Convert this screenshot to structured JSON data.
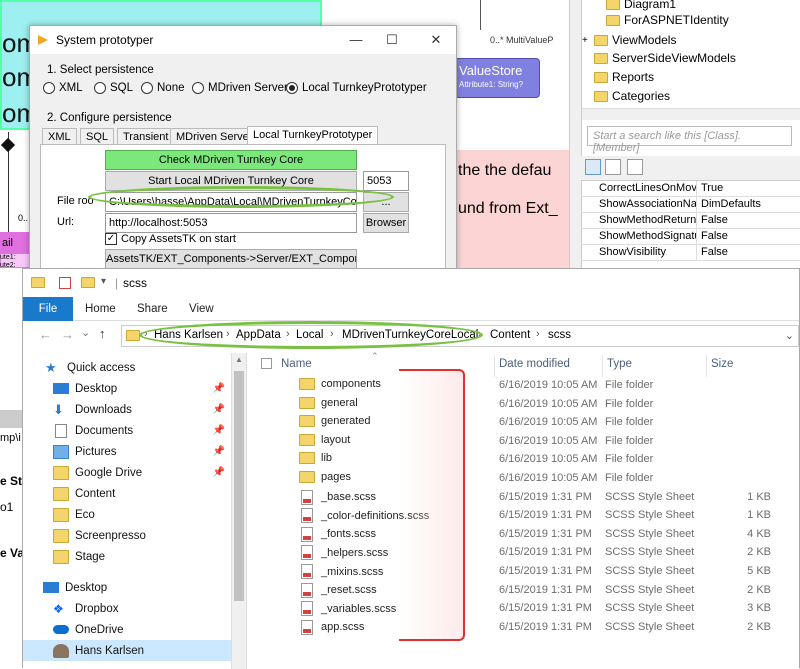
{
  "bg": {
    "big_text": [
      "om",
      "om",
      "om"
    ],
    "pink_label": "ail",
    "pink_attrs": [
      "ute1:",
      "ute2:",
      "ouble",
      "Doub",
      "Colo",
      "Radiu"
    ],
    "left_label_0x": "0..",
    "canvas_label": "0..* MultiValueP",
    "value_store_title": "ValueStore",
    "value_store_attr": "Attribute1: String?",
    "canvas_text_1": "the the defau",
    "canvas_text_2": "und from Ext_",
    "canvas_text_3": "Mu     D     I   f",
    "side_frag_1": "mp\\i",
    "side_frag_2": "e St",
    "side_frag_3": "o1",
    "side_frag_4": "e Va"
  },
  "tree": {
    "items": [
      {
        "label": "Diagram1",
        "indent": 1
      },
      {
        "label": "ForASPNETIdentity",
        "indent": 1
      },
      {
        "label": "ViewModels",
        "indent": 0,
        "expander": "+"
      },
      {
        "label": "ServerSideViewModels",
        "indent": 0
      },
      {
        "label": "Reports",
        "indent": 0
      },
      {
        "label": "Categories",
        "indent": 0
      }
    ],
    "search_placeholder": "Start a search like this [Class].[Member]"
  },
  "props": [
    {
      "name": "CorrectLinesOnMove",
      "value": "True"
    },
    {
      "name": "ShowAssociationNam",
      "value": "DimDefaults"
    },
    {
      "name": "ShowMethodReturnT",
      "value": "False"
    },
    {
      "name": "ShowMethodSignatu",
      "value": "False"
    },
    {
      "name": "ShowVisibility",
      "value": "False"
    }
  ],
  "dialog": {
    "title": "System prototyper",
    "minimize": "—",
    "maximize": "☐",
    "close": "✕",
    "section1": "1. Select persistence",
    "radios": [
      {
        "label": "XML",
        "selected": false
      },
      {
        "label": "SQL",
        "selected": false
      },
      {
        "label": "None",
        "selected": false
      },
      {
        "label": "MDriven Server",
        "selected": false
      },
      {
        "label": "Local TurnkeyPrototyper",
        "selected": true
      }
    ],
    "section2": "2. Configure persistence",
    "tabs": [
      {
        "label": "XML",
        "active": false
      },
      {
        "label": "SQL",
        "active": false
      },
      {
        "label": "Transient",
        "active": false
      },
      {
        "label": "MDriven Server",
        "active": false
      },
      {
        "label": "Local TurnkeyPrototyper",
        "active": true
      }
    ],
    "check_btn": "Check MDriven Turnkey Core",
    "start_btn": "Start Local MDriven Turnkey Core",
    "port": "5053",
    "file_root_label": "File roo",
    "file_root_value": "C:\\Users\\hasse\\AppData\\Local\\MDrivenTurnkeyCoreLoca",
    "browse_dots": "...",
    "url_label": "Url:",
    "url_value": "http://localhost:5053",
    "browser_btn": "Browser",
    "copy_label": "Copy AssetsTK on start",
    "assets_btn": "AssetsTK/EXT_Components->Server/EXT_Components"
  },
  "explorer": {
    "title": "scss",
    "title_sep": "|",
    "ribbon": [
      "File",
      "Home",
      "Share",
      "View"
    ],
    "breadcrumbs": [
      "Hans Karlsen",
      "AppData",
      "Local",
      "MDrivenTurnkeyCoreLocal",
      "Content",
      "scss"
    ],
    "nav_back": "←",
    "nav_forward": "→",
    "nav_recent": "⌄",
    "nav_up": "↑",
    "addr_chevron": "⌄",
    "nav": [
      {
        "label": "Quick access",
        "icon": "star-icon",
        "pinned": false
      },
      {
        "label": "Desktop",
        "icon": "desktop-icon",
        "pinned": true
      },
      {
        "label": "Downloads",
        "icon": "download-icon",
        "pinned": true
      },
      {
        "label": "Documents",
        "icon": "documents-icon",
        "pinned": true
      },
      {
        "label": "Pictures",
        "icon": "pictures-icon",
        "pinned": true
      },
      {
        "label": "Google Drive",
        "icon": "folder-icon",
        "pinned": true
      },
      {
        "label": "Content",
        "icon": "folder-icon",
        "pinned": false
      },
      {
        "label": "Eco",
        "icon": "folder-icon",
        "pinned": false
      },
      {
        "label": "Screenpresso",
        "icon": "folder-icon",
        "pinned": false
      },
      {
        "label": "Stage",
        "icon": "folder-icon",
        "pinned": false
      },
      {
        "label": "Desktop",
        "icon": "desktop-icon",
        "pinned": false
      },
      {
        "label": "Dropbox",
        "icon": "dropbox-icon",
        "pinned": false
      },
      {
        "label": "OneDrive",
        "icon": "cloud-icon",
        "pinned": false
      },
      {
        "label": "Hans Karlsen",
        "icon": "user-icon",
        "pinned": false
      }
    ],
    "columns": {
      "name": "Name",
      "date": "Date modified",
      "type": "Type",
      "size": "Size"
    },
    "files": [
      {
        "name": "components",
        "date": "6/16/2019 10:05 AM",
        "type": "File folder",
        "size": "",
        "kind": "folder"
      },
      {
        "name": "general",
        "date": "6/16/2019 10:05 AM",
        "type": "File folder",
        "size": "",
        "kind": "folder"
      },
      {
        "name": "generated",
        "date": "6/16/2019 10:05 AM",
        "type": "File folder",
        "size": "",
        "kind": "folder"
      },
      {
        "name": "layout",
        "date": "6/16/2019 10:05 AM",
        "type": "File folder",
        "size": "",
        "kind": "folder"
      },
      {
        "name": "lib",
        "date": "6/16/2019 10:05 AM",
        "type": "File folder",
        "size": "",
        "kind": "folder"
      },
      {
        "name": "pages",
        "date": "6/16/2019 10:05 AM",
        "type": "File folder",
        "size": "",
        "kind": "folder"
      },
      {
        "name": "_base.scss",
        "date": "6/15/2019 1:31 PM",
        "type": "SCSS Style Sheet",
        "size": "1 KB",
        "kind": "file"
      },
      {
        "name": "_color-definitions.scss",
        "date": "6/15/2019 1:31 PM",
        "type": "SCSS Style Sheet",
        "size": "1 KB",
        "kind": "file"
      },
      {
        "name": "_fonts.scss",
        "date": "6/15/2019 1:31 PM",
        "type": "SCSS Style Sheet",
        "size": "4 KB",
        "kind": "file"
      },
      {
        "name": "_helpers.scss",
        "date": "6/15/2019 1:31 PM",
        "type": "SCSS Style Sheet",
        "size": "2 KB",
        "kind": "file"
      },
      {
        "name": "_mixins.scss",
        "date": "6/15/2019 1:31 PM",
        "type": "SCSS Style Sheet",
        "size": "5 KB",
        "kind": "file"
      },
      {
        "name": "_reset.scss",
        "date": "6/15/2019 1:31 PM",
        "type": "SCSS Style Sheet",
        "size": "2 KB",
        "kind": "file"
      },
      {
        "name": "_variables.scss",
        "date": "6/15/2019 1:31 PM",
        "type": "SCSS Style Sheet",
        "size": "3 KB",
        "kind": "file"
      },
      {
        "name": "app.scss",
        "date": "6/15/2019 1:31 PM",
        "type": "SCSS Style Sheet",
        "size": "2 KB",
        "kind": "file"
      }
    ]
  },
  "colors": {
    "accent": "#1979ca",
    "annotation_green": "#7ac143",
    "annotation_red": "#e03030",
    "check_green": "#7ce87c"
  }
}
